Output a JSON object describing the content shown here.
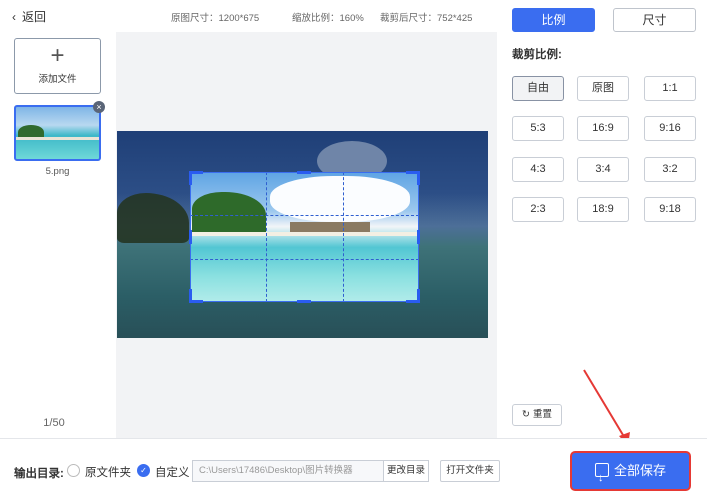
{
  "topbar": {
    "back_label": "返回",
    "original_size": "原图尺寸：1200*675",
    "zoom": "缩放比例：160%",
    "crop_size": "裁剪后尺寸：752*425"
  },
  "sidebar": {
    "add_file_label": "添加文件",
    "thumbnail": {
      "filename": "5.png"
    },
    "page_count": "1/50"
  },
  "panel": {
    "tabs": [
      {
        "label": "比例",
        "active": true
      },
      {
        "label": "尺寸",
        "active": false
      }
    ],
    "ratio_title": "裁剪比例:",
    "ratios": [
      "自由",
      "原图",
      "1:1",
      "5:3",
      "16:9",
      "9:16",
      "4:3",
      "3:4",
      "3:2",
      "2:3",
      "18:9",
      "9:18"
    ],
    "selected_ratio": "自由",
    "reset_label": "重置"
  },
  "bottom": {
    "output_label": "输出目录:",
    "option_original": "原文件夹",
    "option_custom": "自定义",
    "selected_option": "自定义",
    "path_value": "C:\\Users\\17486\\Desktop\\图片转换器",
    "change_dir_label": "更改目录",
    "open_folder_label": "打开文件夹",
    "save_all_label": "全部保存"
  },
  "colors": {
    "accent": "#3a6df0",
    "highlight_arrow": "#e53935"
  }
}
